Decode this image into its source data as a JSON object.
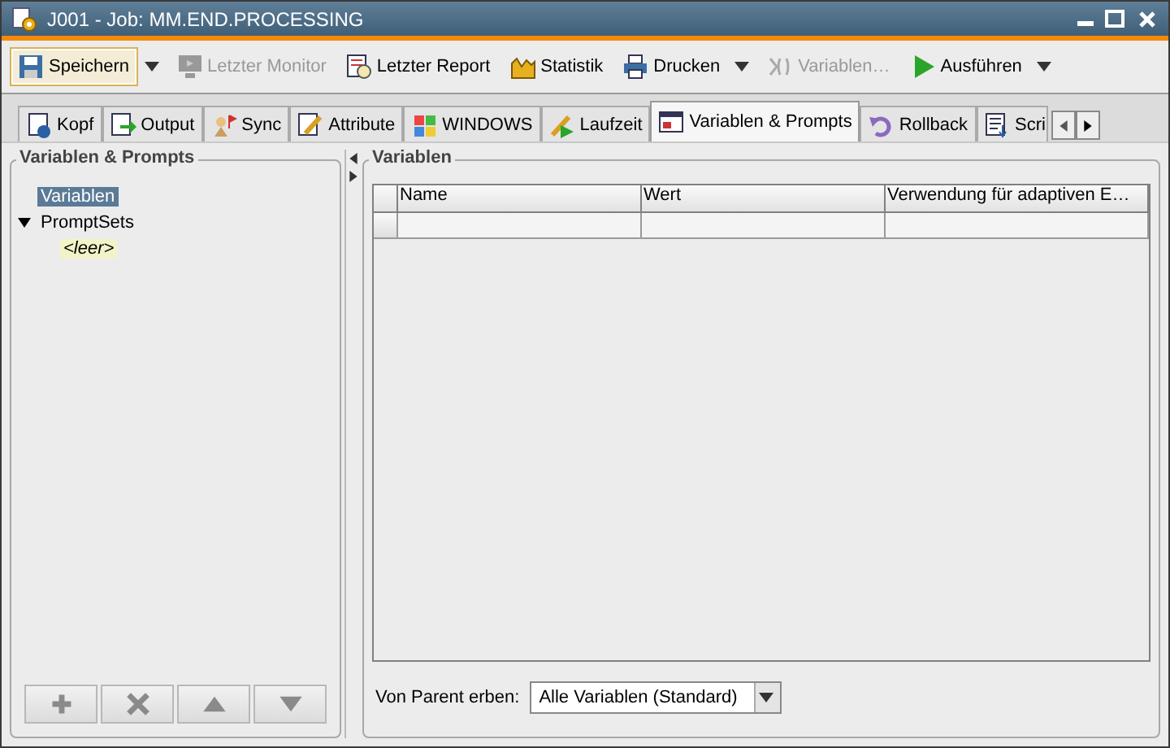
{
  "window": {
    "title": "J001 - Job: MM.END.PROCESSING"
  },
  "toolbar": [
    {
      "label": "Speichern",
      "pressed": true,
      "disabled": false,
      "menu": true
    },
    {
      "label": "Letzter Monitor",
      "pressed": false,
      "disabled": true,
      "menu": false
    },
    {
      "label": "Letzter Report",
      "pressed": false,
      "disabled": false,
      "menu": false
    },
    {
      "label": "Statistik",
      "pressed": false,
      "disabled": false,
      "menu": false
    },
    {
      "label": "Drucken",
      "pressed": false,
      "disabled": false,
      "menu": true
    },
    {
      "label": "Variablen…",
      "pressed": false,
      "disabled": true,
      "menu": false
    },
    {
      "label": "Ausführen",
      "pressed": false,
      "disabled": false,
      "menu": true
    }
  ],
  "tabs": [
    {
      "label": "Kopf",
      "selected": false
    },
    {
      "label": "Output",
      "selected": false
    },
    {
      "label": "Sync",
      "selected": false
    },
    {
      "label": "Attribute",
      "selected": false
    },
    {
      "label": "WINDOWS",
      "selected": false
    },
    {
      "label": "Laufzeit",
      "selected": false
    },
    {
      "label": "Variablen & Prompts",
      "selected": true
    },
    {
      "label": "Rollback",
      "selected": false
    },
    {
      "label": "Scri",
      "selected": false
    }
  ],
  "left_panel": {
    "title": "Variablen & Prompts",
    "tree": [
      {
        "label": "Variablen",
        "selected": true
      },
      {
        "label": "PromptSets",
        "selected": false,
        "expanded": true,
        "children": [
          {
            "label": "<leer>",
            "selected": false,
            "kind": "empty"
          }
        ]
      }
    ]
  },
  "right_panel": {
    "title": "Variablen",
    "table": {
      "columns": [
        "Name",
        "Wert",
        "Verwendung für adaptiven E…"
      ]
    },
    "inherit": {
      "label": "Von Parent erben:",
      "value": "Alle Variablen (Standard)"
    }
  }
}
